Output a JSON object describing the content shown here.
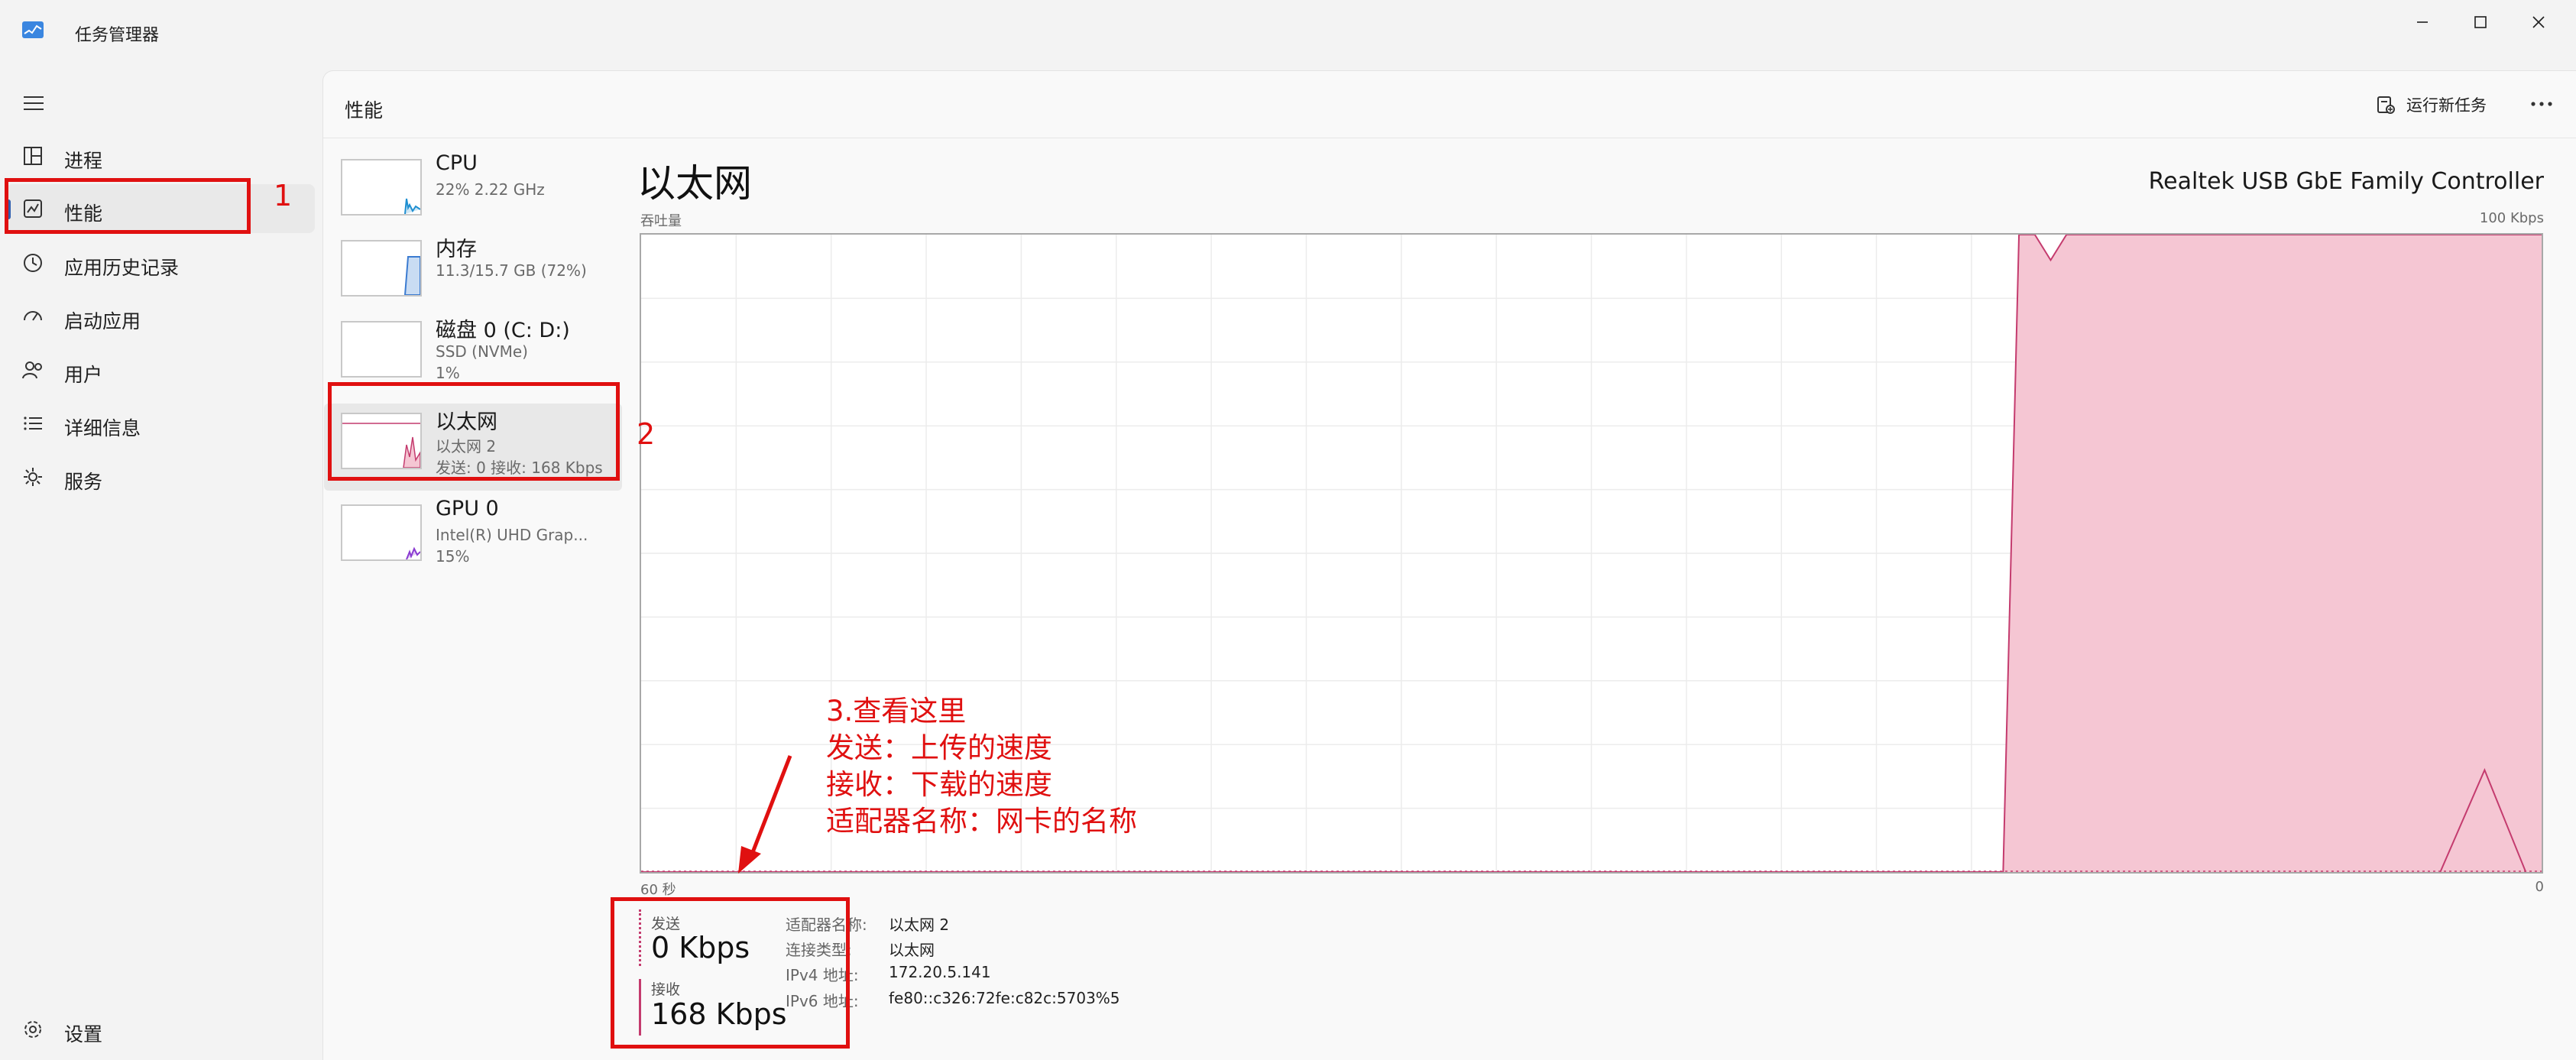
{
  "titlebar": {
    "title": "任务管理器"
  },
  "nav": {
    "items": [
      {
        "label": "进程",
        "icon": "processes-icon"
      },
      {
        "label": "性能",
        "icon": "performance-icon",
        "active": true
      },
      {
        "label": "应用历史记录",
        "icon": "app-history-icon"
      },
      {
        "label": "启动应用",
        "icon": "startup-apps-icon"
      },
      {
        "label": "用户",
        "icon": "users-icon"
      },
      {
        "label": "详细信息",
        "icon": "details-icon"
      },
      {
        "label": "服务",
        "icon": "services-icon"
      }
    ],
    "settings": {
      "label": "设置",
      "icon": "settings-icon"
    }
  },
  "header": {
    "title": "性能",
    "run_task_label": "运行新任务",
    "more_icon": "more-icon"
  },
  "resources": [
    {
      "name": "CPU",
      "sub1": "22% 2.22 GHz",
      "sub2": "",
      "color": "#1f8fd1"
    },
    {
      "name": "内存",
      "sub1": "11.3/15.7 GB (72%)",
      "sub2": "",
      "color": "#3b7bd1"
    },
    {
      "name": "磁盘 0 (C: D:)",
      "sub1": "SSD (NVMe)",
      "sub2": "1%",
      "color": "#3c9a3c"
    },
    {
      "name": "以太网",
      "sub1": "以太网 2",
      "sub2": "发送: 0 接收: 168 Kbps",
      "color": "#c43b6e",
      "selected": true
    },
    {
      "name": "GPU 0",
      "sub1": "Intel(R) UHD Grap...",
      "sub2": "15%",
      "color": "#8a3bd1"
    }
  ],
  "detail": {
    "title": "以太网",
    "adapter": "Realtek USB GbE Family Controller",
    "throughput_label": "吞吐量",
    "ymax_label": "100 Kbps",
    "xleft_label": "60 秒",
    "xright_label": "0",
    "send_label": "发送",
    "send_value": "0 Kbps",
    "recv_label": "接收",
    "recv_value": "168 Kbps",
    "props": [
      {
        "key": "适配器名称:",
        "value": "以太网 2"
      },
      {
        "key": "连接类型:",
        "value": "以太网"
      },
      {
        "key": "IPv4 地址:",
        "value": "172.20.5.141"
      },
      {
        "key": "IPv6 地址:",
        "value": "fe80::c326:72fe:c82c:5703%5"
      }
    ]
  },
  "chart_data": {
    "type": "area",
    "x": [
      60,
      17,
      16.5,
      16,
      15.5,
      15,
      14.5,
      1.5,
      0
    ],
    "receive": [
      0,
      0,
      100,
      100,
      96,
      100,
      100,
      100,
      100
    ],
    "send": [
      0,
      0,
      0,
      0,
      0,
      0,
      0,
      0,
      0
    ],
    "secondary_peak": {
      "x": [
        3.2,
        1.8,
        0.5
      ],
      "y": [
        0,
        16,
        0
      ]
    },
    "ylim": [
      0,
      100
    ],
    "xlim": [
      60,
      0
    ],
    "grid": true,
    "color": "#c43b6e",
    "fill": "#f5c6d3"
  },
  "annotations": {
    "n1": "1",
    "n2": "2",
    "lines": [
      "3.查看这里",
      "发送：上传的速度",
      "接收：下载的速度",
      "适配器名称：网卡的名称"
    ]
  }
}
